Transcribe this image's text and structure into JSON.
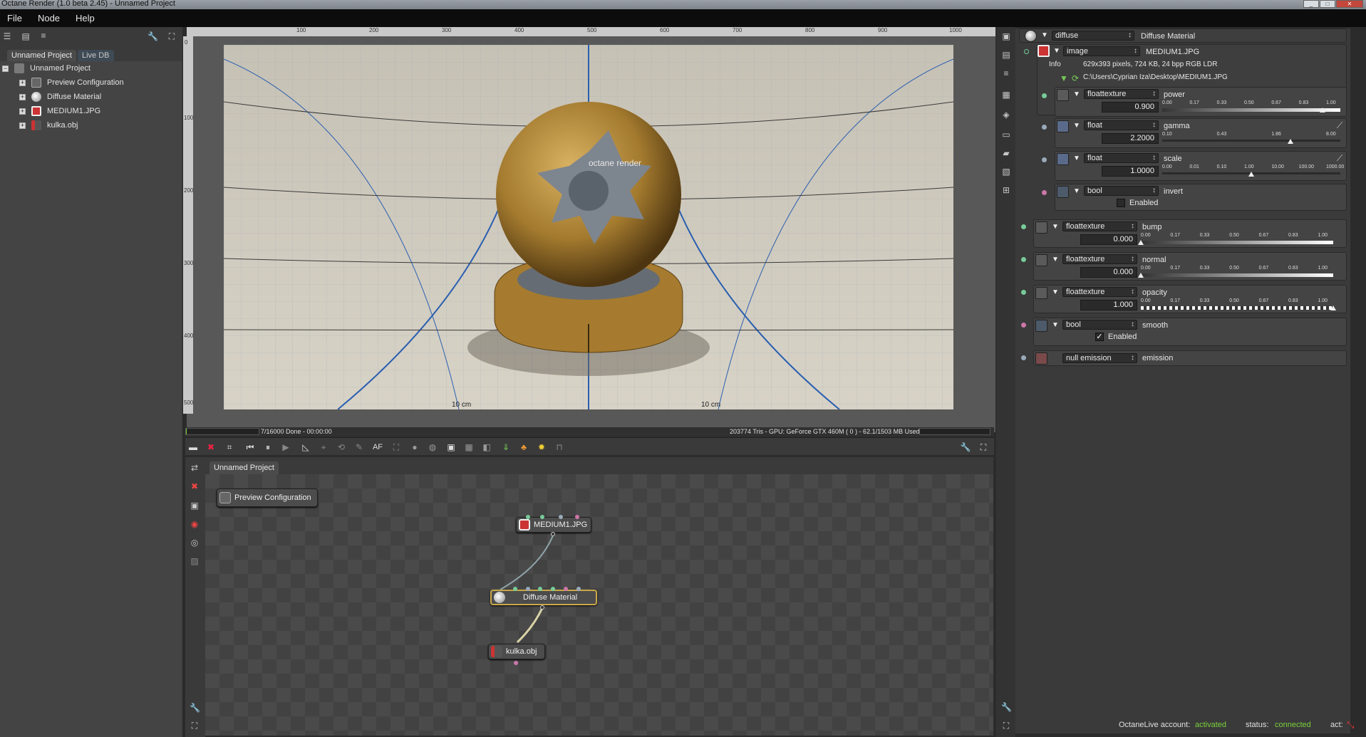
{
  "window": {
    "title": "Octane Render (1.0 beta 2.45) - Unnamed Project"
  },
  "menu": {
    "items": [
      "File",
      "Node",
      "Help"
    ]
  },
  "scene": {
    "tabs": [
      "Unnamed Project",
      "Live DB"
    ],
    "root": "Unnamed Project",
    "items": [
      "Preview Configuration",
      "Diffuse Material",
      "MEDIUM1.JPG",
      "kulka.obj"
    ]
  },
  "viewport": {
    "ruler_h": [
      "100",
      "200",
      "300",
      "400",
      "500",
      "600",
      "700",
      "800",
      "900",
      "1000"
    ],
    "ruler_v": [
      "0",
      "100",
      "200",
      "300",
      "400",
      "500"
    ],
    "render_label_left": "10 cm",
    "render_label_right": "10 cm",
    "watermark": "octane render"
  },
  "status": {
    "progress": "7/16000 Done - 00:00:00",
    "progress_fraction": 0.0004,
    "gpu": "203774 Tris - GPU: GeForce GTX 460M ( 0 ) - 62.1/1503 MB Used"
  },
  "toolbar": {
    "af_label": "AF"
  },
  "graph": {
    "tab": "Unnamed Project",
    "preview_node": "Preview Configuration",
    "image_node": "MEDIUM1.JPG",
    "material_node": "Diffuse Material",
    "mesh_node": "kulka.obj"
  },
  "props": {
    "header": {
      "type": "diffuse",
      "name": "Diffuse Material"
    },
    "image": {
      "type": "image",
      "name": "MEDIUM1.JPG",
      "info_label": "Info",
      "info": "629x393 pixels, 724 KB, 24 bpp RGB LDR",
      "path": "C:\\Users\\Cyprian Iza\\Desktop\\MEDIUM1.JPG"
    },
    "power": {
      "type": "floattexture",
      "name": "power",
      "value": "0.900",
      "marks": [
        "0.00",
        "0.17",
        "0.33",
        "0.50",
        "0.67",
        "0.83",
        "1.00"
      ],
      "level": 0.9
    },
    "gamma": {
      "type": "float",
      "name": "gamma",
      "value": "2.2000",
      "marks": [
        "0.10",
        "0.43",
        "1.86",
        "8.00"
      ],
      "level": 0.72
    },
    "scale": {
      "type": "float",
      "name": "scale",
      "value": "1.0000",
      "marks": [
        "0.00",
        "0.01",
        "0.10",
        "1.00",
        "10.00",
        "100.00",
        "1000.00"
      ],
      "level": 0.5
    },
    "invert": {
      "type": "bool",
      "name": "invert",
      "checkbox": "Enabled",
      "checked": false
    },
    "bump": {
      "type": "floattexture",
      "name": "bump",
      "value": "0.000",
      "marks": [
        "0.00",
        "0.17",
        "0.33",
        "0.50",
        "0.67",
        "0.83",
        "1.00"
      ],
      "level": 0.0
    },
    "normal": {
      "type": "floattexture",
      "name": "normal",
      "value": "0.000",
      "marks": [
        "0.00",
        "0.17",
        "0.33",
        "0.50",
        "0.67",
        "0.83",
        "1.00"
      ],
      "level": 0.0
    },
    "opacity": {
      "type": "floattexture",
      "name": "opacity",
      "value": "1.000",
      "marks": [
        "0.00",
        "0.17",
        "0.33",
        "0.50",
        "0.67",
        "0.83",
        "1.00"
      ],
      "level": 1.0
    },
    "smooth": {
      "type": "bool",
      "name": "smooth",
      "checkbox": "Enabled",
      "checked": true
    },
    "emission": {
      "type": "null emission",
      "name": "emission"
    }
  },
  "footer": {
    "account_label": "OctaneLive account:",
    "account_value": "activated",
    "status_label": "status:",
    "status_value": "connected",
    "act_label": "act:"
  },
  "colors": {
    "accent_green": "#7ad13a",
    "node_outline": "#c9a84a",
    "background": "#2b2b2b"
  }
}
